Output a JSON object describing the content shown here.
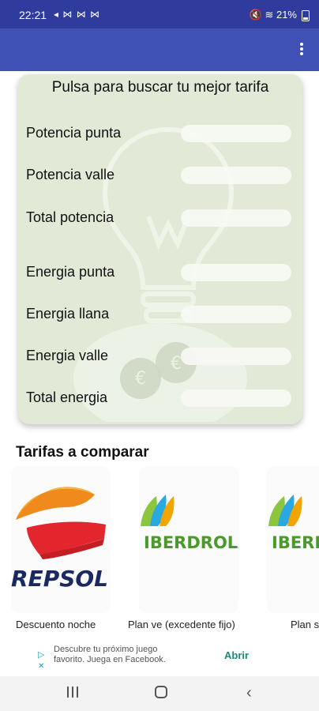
{
  "status_bar": {
    "time": "22:21",
    "notif_icons": "◂ ⋈ ⋈ ⋈",
    "right": "🔇 ≋ 21%"
  },
  "card": {
    "title": "Pulsa para buscar tu mejor tarifa",
    "rows": [
      {
        "label": "Potencia punta"
      },
      {
        "label": "Potencia valle"
      },
      {
        "label": "Total potencia"
      },
      {
        "label": "Energia punta"
      },
      {
        "label": "Energia llana"
      },
      {
        "label": "Energia valle"
      },
      {
        "label": "Total energia"
      }
    ]
  },
  "section": {
    "title": "Tarifas a comparar"
  },
  "tariffs": [
    {
      "brand": "REPSOL",
      "caption": "Descuento noche"
    },
    {
      "brand": "IBERDROLA",
      "caption": "Plan ve (excedente fijo)"
    },
    {
      "brand": "IBERDROLA",
      "caption": "Plan s"
    }
  ],
  "ad": {
    "text": "Descubre tu próximo juego favorito. Juega en Facebook.",
    "button": "Abrir"
  },
  "colors": {
    "status_bar": "#2f3c9e",
    "app_bar": "#3f51b5",
    "card_bg": "#e2ead7"
  }
}
